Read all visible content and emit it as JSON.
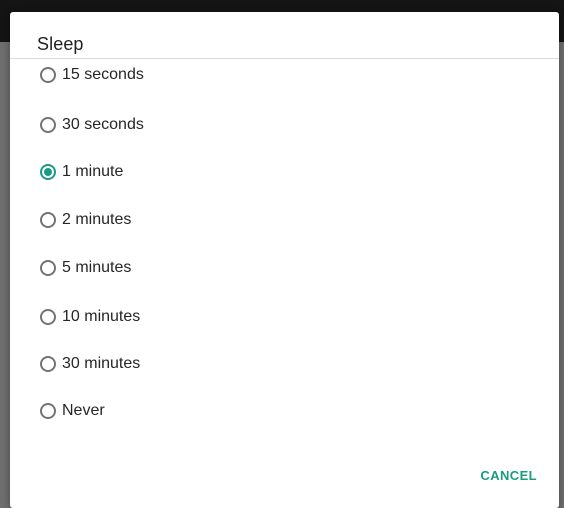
{
  "dialog": {
    "title": "Sleep",
    "options": [
      {
        "label": "15 seconds",
        "selected": false
      },
      {
        "label": "30 seconds",
        "selected": false
      },
      {
        "label": "1 minute",
        "selected": true
      },
      {
        "label": "2 minutes",
        "selected": false
      },
      {
        "label": "5 minutes",
        "selected": false
      },
      {
        "label": "10 minutes",
        "selected": false
      },
      {
        "label": "30 minutes",
        "selected": false
      },
      {
        "label": "Never",
        "selected": false
      }
    ],
    "cancel_label": "CANCEL"
  },
  "colors": {
    "accent": "#1b9b84",
    "scrim": "#6e6e6e",
    "status_bar": "#141414",
    "dialog_background": "#ffffff"
  }
}
